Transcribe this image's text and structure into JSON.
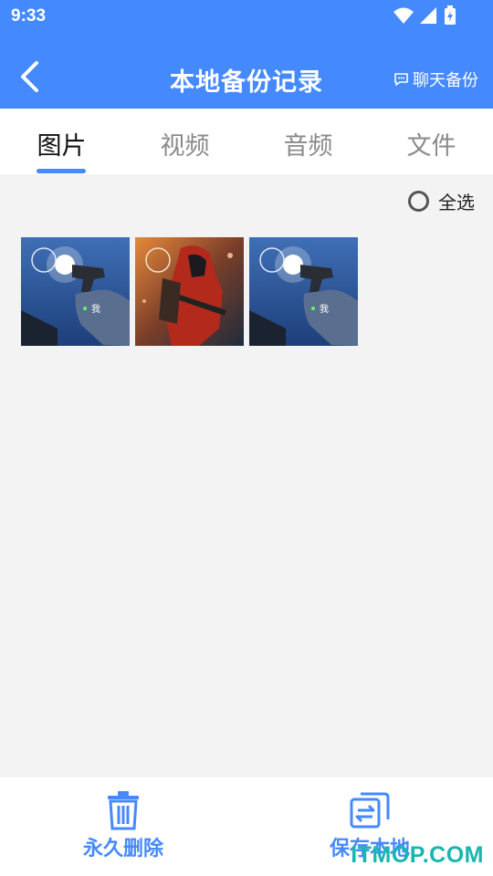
{
  "status_bar": {
    "time": "9:33"
  },
  "header": {
    "title": "本地备份记录",
    "chat_backup_label": "聊天备份"
  },
  "tabs": [
    {
      "label": "图片",
      "active": true
    },
    {
      "label": "视频",
      "active": false
    },
    {
      "label": "音频",
      "active": false
    },
    {
      "label": "文件",
      "active": false
    }
  ],
  "select_all_label": "全选",
  "images": [
    {
      "caption": "我"
    },
    {
      "caption": ""
    },
    {
      "caption": "我"
    }
  ],
  "bottom": {
    "delete_label": "永久删除",
    "save_label": "保存本地"
  },
  "watermark": "ITMOP.COM",
  "colors": {
    "accent": "#4589ff",
    "background": "#f3f3f3"
  }
}
